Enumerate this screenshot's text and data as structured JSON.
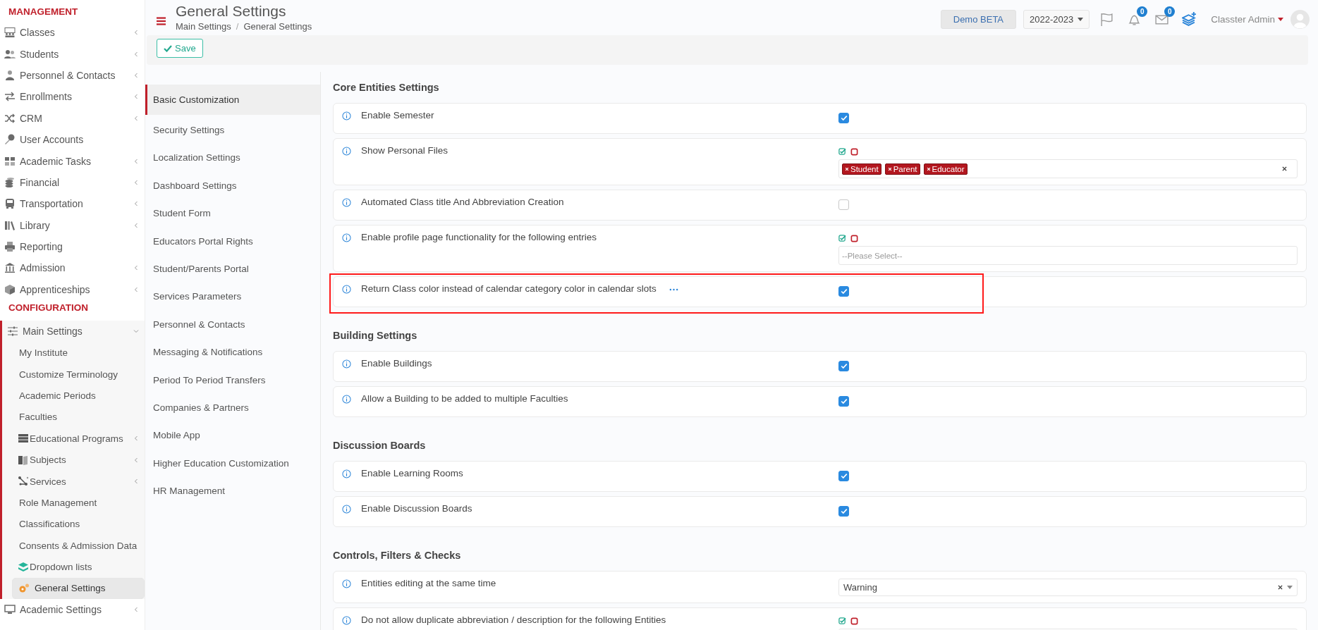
{
  "header": {
    "title": "General Settings",
    "breadcrumb": [
      "Main Settings",
      "General Settings"
    ],
    "breadcrumb_separator": "/",
    "demo_button": "Demo BETA",
    "year": "2022-2023",
    "notifications": "0",
    "messages": "0",
    "user": "Classter Admin"
  },
  "toolbar": {
    "save": "Save"
  },
  "sidebar": {
    "sections": [
      {
        "title": "MANAGEMENT",
        "items": [
          {
            "label": "Classes",
            "expandable": true,
            "expanded": false,
            "selected": false
          },
          {
            "label": "Students",
            "expandable": true,
            "expanded": false,
            "selected": false
          },
          {
            "label": "Personnel & Contacts",
            "expandable": true,
            "expanded": false,
            "selected": false
          },
          {
            "label": "Enrollments",
            "expandable": true,
            "expanded": false,
            "selected": false
          },
          {
            "label": "CRM",
            "expandable": true,
            "expanded": false,
            "selected": false
          },
          {
            "label": "User Accounts",
            "expandable": false,
            "selected": false
          },
          {
            "label": "Academic Tasks",
            "expandable": true,
            "expanded": false,
            "selected": false
          },
          {
            "label": "Financial",
            "expandable": true,
            "expanded": false,
            "selected": false
          },
          {
            "label": "Transportation",
            "expandable": true,
            "expanded": false,
            "selected": false
          },
          {
            "label": "Library",
            "expandable": true,
            "expanded": false,
            "selected": false
          },
          {
            "label": "Reporting",
            "expandable": false,
            "selected": false
          },
          {
            "label": "Admission",
            "expandable": true,
            "expanded": false,
            "selected": false
          },
          {
            "label": "Apprenticeships",
            "expandable": true,
            "expanded": false,
            "selected": false
          }
        ]
      },
      {
        "title": "CONFIGURATION",
        "items": [
          {
            "label": "Main Settings",
            "expandable": true,
            "expanded": true,
            "selected": false,
            "children": [
              {
                "label": "My Institute",
                "expandable": false,
                "selected": false
              },
              {
                "label": "Customize Terminology",
                "expandable": false,
                "selected": false
              },
              {
                "label": "Academic Periods",
                "expandable": false,
                "selected": false
              },
              {
                "label": "Faculties",
                "expandable": false,
                "selected": false
              },
              {
                "label": "Educational Programs",
                "expandable": true,
                "expanded": false,
                "selected": false
              },
              {
                "label": "Subjects",
                "expandable": true,
                "expanded": false,
                "selected": false
              },
              {
                "label": "Services",
                "expandable": true,
                "expanded": false,
                "selected": false
              },
              {
                "label": "Role Management",
                "expandable": false,
                "selected": false
              },
              {
                "label": "Classifications",
                "expandable": false,
                "selected": false
              },
              {
                "label": "Consents & Admission Data",
                "expandable": false,
                "selected": false
              },
              {
                "label": "Dropdown lists",
                "expandable": false,
                "selected": false
              },
              {
                "label": "General Settings",
                "expandable": false,
                "selected": true
              }
            ]
          },
          {
            "label": "Academic Settings",
            "expandable": true,
            "expanded": false,
            "selected": false
          }
        ]
      }
    ]
  },
  "settings_nav": [
    {
      "label": "Basic Customization",
      "selected": true
    },
    {
      "label": "Security Settings",
      "selected": false
    },
    {
      "label": "Localization Settings",
      "selected": false
    },
    {
      "label": "Dashboard Settings",
      "selected": false
    },
    {
      "label": "Student Form",
      "selected": false
    },
    {
      "label": "Educators Portal Rights",
      "selected": false
    },
    {
      "label": "Student/Parents Portal",
      "selected": false
    },
    {
      "label": "Services Parameters",
      "selected": false
    },
    {
      "label": "Personnel & Contacts",
      "selected": false
    },
    {
      "label": "Messaging & Notifications",
      "selected": false
    },
    {
      "label": "Period To Period Transfers",
      "selected": false
    },
    {
      "label": "Companies & Partners",
      "selected": false
    },
    {
      "label": "Mobile App",
      "selected": false
    },
    {
      "label": "Higher Education Customization",
      "selected": false
    },
    {
      "label": "HR Management",
      "selected": false
    }
  ],
  "sections": [
    {
      "title": "Core Entities Settings",
      "rows": [
        {
          "kind": "checkbox",
          "label": "Enable Semester",
          "checked": true,
          "more": false,
          "highlighted": false
        },
        {
          "kind": "multiselect",
          "label": "Show Personal Files",
          "tags": [
            "Student",
            "Parent",
            "Educator"
          ],
          "more": false,
          "highlighted": false
        },
        {
          "kind": "checkbox",
          "label": "Automated Class title And Abbreviation Creation",
          "checked": false,
          "more": false,
          "highlighted": false
        },
        {
          "kind": "multiselect",
          "label": "Enable profile page functionality for the following entries",
          "placeholder": "--Please Select--",
          "more": false,
          "highlighted": false
        },
        {
          "kind": "checkbox",
          "label": "Return Class color instead of calendar category color in calendar slots",
          "checked": true,
          "more": true,
          "highlighted": true
        }
      ]
    },
    {
      "title": "Building Settings",
      "rows": [
        {
          "kind": "checkbox",
          "label": "Enable Buildings",
          "checked": true,
          "more": false,
          "highlighted": false
        },
        {
          "kind": "checkbox",
          "label": "Allow a Building to be added to multiple Faculties",
          "checked": true,
          "more": false,
          "highlighted": false
        }
      ]
    },
    {
      "title": "Discussion Boards",
      "rows": [
        {
          "kind": "checkbox",
          "label": "Enable Learning Rooms",
          "checked": true,
          "more": false,
          "highlighted": false
        },
        {
          "kind": "checkbox",
          "label": "Enable Discussion Boards",
          "checked": true,
          "more": false,
          "highlighted": false
        }
      ]
    },
    {
      "title": "Controls, Filters & Checks",
      "rows": [
        {
          "kind": "select",
          "label": "Entities editing at the same time",
          "value": "Warning",
          "more": false,
          "highlighted": false
        },
        {
          "kind": "multiselect",
          "label": "Do not allow duplicate abbreviation / description for the following Entities",
          "more": false,
          "highlighted": false
        }
      ]
    }
  ]
}
